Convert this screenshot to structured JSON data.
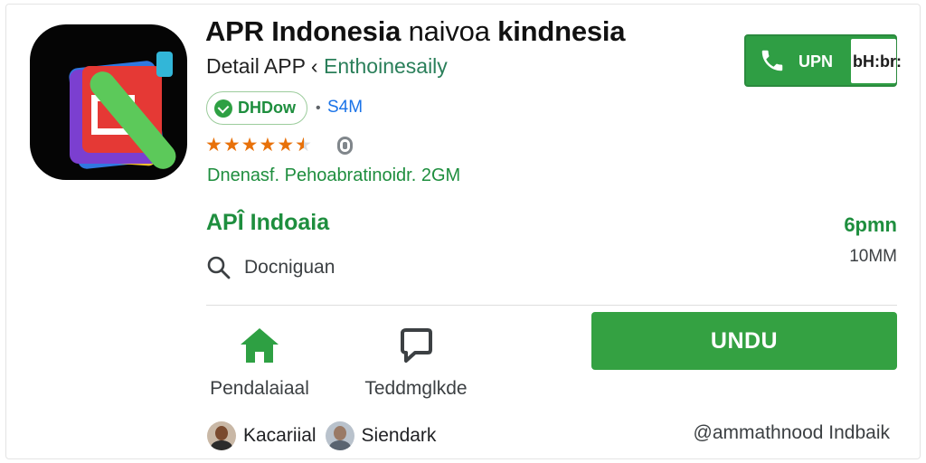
{
  "app": {
    "title_bold": "APR Indonesia",
    "title_light": "naivoa",
    "title_end": "kindnesia",
    "subtitle": "Detail APP",
    "subtitle_sep": "‹",
    "subtitle_accent": "Enthoinesaily",
    "badge_label": "DHDow",
    "badge_meta": "S4M",
    "rating_stars_full": 5,
    "rating_stars_half": 1,
    "developer": "Dnenasf. Pehoabratinoidr. 2GM"
  },
  "top_button": {
    "label": "UPN",
    "label_tail": "bH:br:",
    "icon": "phone-icon"
  },
  "section": {
    "title": "APÎ Indoaia",
    "right_value": "6pmn",
    "size": "10MM",
    "search_label": "Docniguan"
  },
  "nav": {
    "home_label": "Pendalaiaal",
    "home_icon": "home-icon",
    "msg_label": "Teddmglkde",
    "msg_icon": "message-icon"
  },
  "install_button": {
    "label": "UNDU"
  },
  "people": [
    {
      "name": "Kacariial"
    },
    {
      "name": "Siendark"
    }
  ],
  "handle": "@ammathnood Indbaik",
  "colors": {
    "accent_green": "#34a142",
    "text_green": "#1e8e3e",
    "star_orange": "#e8710a",
    "link_blue": "#1a73e8"
  }
}
